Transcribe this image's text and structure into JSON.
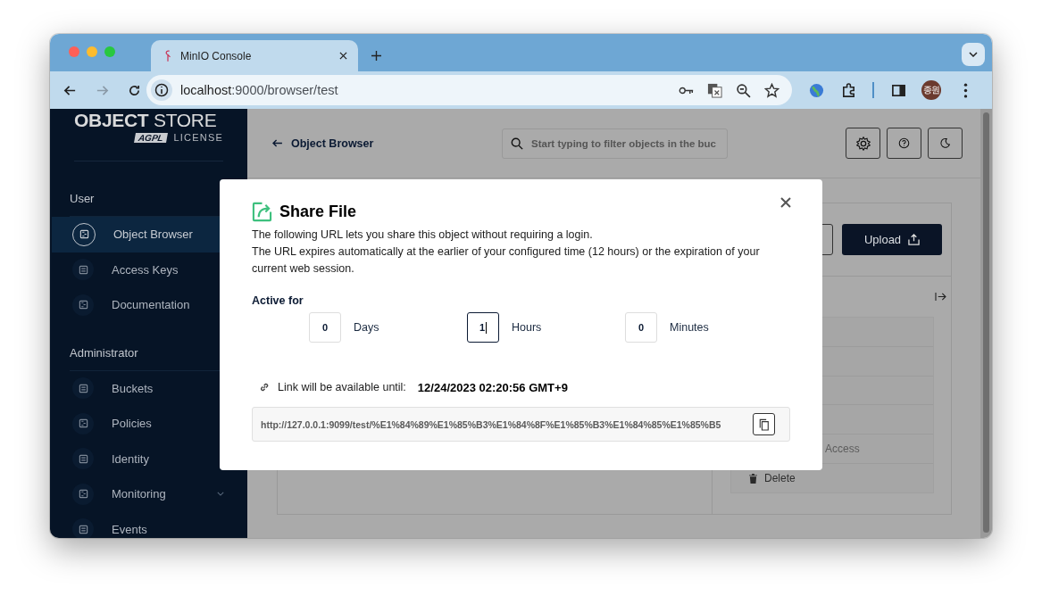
{
  "browser": {
    "tab_title": "MinIO Console",
    "address_host": "localhost",
    "address_path": ":9000/browser/test",
    "profile_initials": "종원"
  },
  "sidebar": {
    "logo_bold": "OBJECT",
    "logo_light": "STORE",
    "license_badge": "AGPL",
    "license": "LICENSE",
    "sections": [
      {
        "title": "User",
        "items": [
          {
            "label": "Object Browser",
            "selected": true,
            "expandable": false
          },
          {
            "label": "Access Keys",
            "selected": false,
            "expandable": false
          },
          {
            "label": "Documentation",
            "selected": false,
            "expandable": false
          }
        ]
      },
      {
        "title": "Administrator",
        "items": [
          {
            "label": "Buckets",
            "selected": false,
            "expandable": false
          },
          {
            "label": "Policies",
            "selected": false,
            "expandable": false
          },
          {
            "label": "Identity",
            "selected": false,
            "expandable": false
          },
          {
            "label": "Monitoring",
            "selected": false,
            "expandable": true
          },
          {
            "label": "Events",
            "selected": false,
            "expandable": false
          }
        ]
      }
    ]
  },
  "header": {
    "back_label": "Object Browser",
    "search_placeholder": "Start typing to filter objects in the buc"
  },
  "toolbar": {
    "upload_label": "Upload"
  },
  "actions": [
    {
      "label": "Access",
      "disabled": true
    },
    {
      "label": "Delete",
      "disabled": false
    }
  ],
  "dialog": {
    "title": "Share File",
    "lines": [
      "The following URL lets you share this object without requiring a login.",
      "The URL expires automatically at the earlier of your configured time (12 hours) or the expiration of your current web session."
    ],
    "active_label": "Active for",
    "durations": [
      {
        "value": "0",
        "unit": "Days",
        "focused": false
      },
      {
        "value": "1",
        "unit": "Hours",
        "focused": true
      },
      {
        "value": "0",
        "unit": "Minutes",
        "focused": false
      }
    ],
    "until_label": "Link will be available until:",
    "until_value": "12/24/2023 02:20:56 GMT+9",
    "url": "http://127.0.0.1:9099/test/%E1%84%89%E1%85%B3%E1%84%8F%E1%85%B3%E1%84%85%E1%85%B5"
  }
}
